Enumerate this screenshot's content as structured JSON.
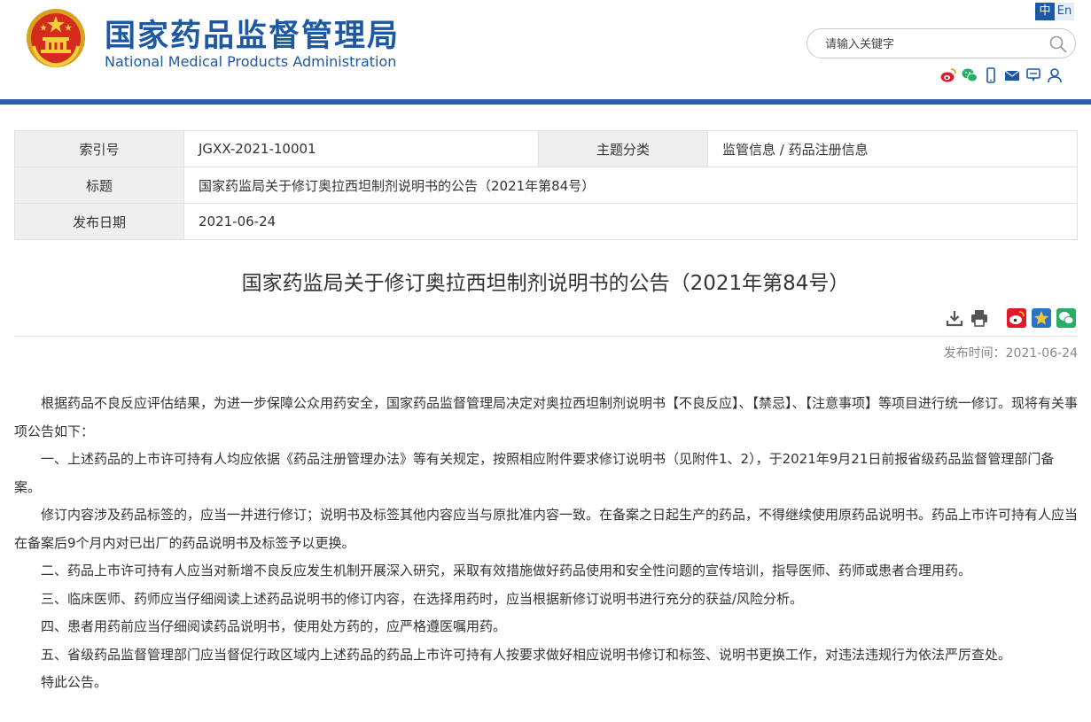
{
  "header": {
    "title_cn": "国家药品监督管理局",
    "title_en": "National Medical Products Administration",
    "lang_cn": "中",
    "lang_en": "En",
    "search_placeholder": "请输入关键字",
    "social_icons": [
      "weibo-icon",
      "wechat-icon",
      "mobile-icon",
      "mail-icon",
      "feedback-icon",
      "user-icon"
    ]
  },
  "info_table": {
    "index_label": "索引号",
    "index_value": "JGXX-2021-10001",
    "category_label": "主题分类",
    "category_value": "监管信息 / 药品注册信息",
    "title_label": "标题",
    "title_value": "国家药监局关于修订奥拉西坦制剂说明书的公告（2021年第84号）",
    "date_label": "发布日期",
    "date_value": "2021-06-24"
  },
  "article": {
    "title": "国家药监局关于修订奥拉西坦制剂说明书的公告（2021年第84号）",
    "publish_time": "发布时间：2021-06-24",
    "paragraphs": [
      "根据药品不良反应评估结果，为进一步保障公众用药安全，国家药品监督管理局决定对奥拉西坦制剂说明书【不良反应】、【禁忌】、【注意事项】等项目进行统一修订。现将有关事项公告如下：",
      "一、上述药品的上市许可持有人均应依据《药品注册管理办法》等有关规定，按照相应附件要求修订说明书（见附件1、2），于2021年9月21日前报省级药品监督管理部门备案。",
      "修订内容涉及药品标签的，应当一并进行修订；说明书及标签其他内容应当与原批准内容一致。在备案之日起生产的药品，不得继续使用原药品说明书。药品上市许可持有人应当在备案后9个月内对已出厂的药品说明书及标签予以更换。",
      "二、药品上市许可持有人应当对新增不良反应发生机制开展深入研究，采取有效措施做好药品使用和安全性问题的宣传培训，指导医师、药师或患者合理用药。",
      "三、临床医师、药师应当仔细阅读上述药品说明书的修订内容，在选择用药时，应当根据新修订说明书进行充分的获益/风险分析。",
      "四、患者用药前应当仔细阅读药品说明书，使用处方药的，应严格遵医嘱用药。",
      "五、省级药品监督管理部门应当督促行政区域内上述药品的药品上市许可持有人按要求做好相应说明书修订和标签、说明书更换工作，对违法违规行为依法严厉查处。",
      "特此公告。"
    ],
    "tool_icons": [
      "download-icon",
      "print-icon",
      "weibo-share-icon",
      "qzone-share-icon",
      "wechat-share-icon"
    ]
  },
  "colors": {
    "brand_blue": "#1d58a5",
    "header_bar": "#2b5fa6",
    "table_key_bg": "#efefef"
  }
}
